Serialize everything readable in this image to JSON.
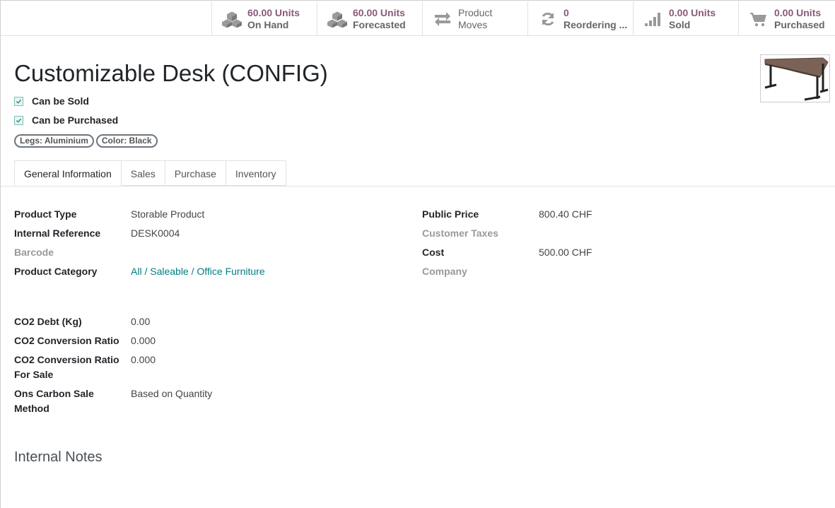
{
  "stat_buttons": [
    {
      "value": "60.00 Units",
      "label": "On Hand",
      "icon": "cubes-icon"
    },
    {
      "value": "60.00 Units",
      "label": "Forecasted",
      "icon": "cubes-icon"
    },
    {
      "value": "Product",
      "label": "Moves",
      "icon": "exchange-icon"
    },
    {
      "value": "0",
      "label": "Reordering ...",
      "icon": "refresh-icon"
    },
    {
      "value": "0.00 Units",
      "label": "Sold",
      "icon": "signal-icon"
    },
    {
      "value": "0.00 Units",
      "label": "Purchased",
      "icon": "cart-icon"
    }
  ],
  "product": {
    "name": "Customizable Desk (CONFIG)",
    "can_be_sold_label": "Can be Sold",
    "can_be_purchased_label": "Can be Purchased",
    "can_be_sold": true,
    "can_be_purchased": true,
    "attributes": [
      "Legs: Aluminium",
      "Color: Black"
    ]
  },
  "tabs": [
    "General Information",
    "Sales",
    "Purchase",
    "Inventory"
  ],
  "active_tab": "General Information",
  "general": {
    "left": [
      {
        "label": "Product Type",
        "value": "Storable Product"
      },
      {
        "label": "Internal Reference",
        "value": "DESK0004"
      },
      {
        "label": "Barcode",
        "value": ""
      },
      {
        "label": "Product Category",
        "value": "All / Saleable / Office Furniture"
      }
    ],
    "right": [
      {
        "label": "Public Price",
        "value": "800.40 CHF"
      },
      {
        "label": "Customer Taxes",
        "value": ""
      },
      {
        "label": "Cost",
        "value": "500.00 CHF"
      },
      {
        "label": "Company",
        "value": ""
      }
    ],
    "co2": [
      {
        "label": "CO2 Debt (Kg)",
        "value": "0.00"
      },
      {
        "label": "CO2 Conversion Ratio",
        "value": "0.000"
      },
      {
        "label": "CO2 Conversion Ratio For Sale",
        "value": "0.000"
      },
      {
        "label": "Ons Carbon Sale Method",
        "value": "Based on Quantity"
      }
    ]
  },
  "internal_notes_title": "Internal Notes",
  "colors": {
    "accent": "#875a7b",
    "link": "#017e84",
    "checkbox": "#7cbcb7"
  }
}
